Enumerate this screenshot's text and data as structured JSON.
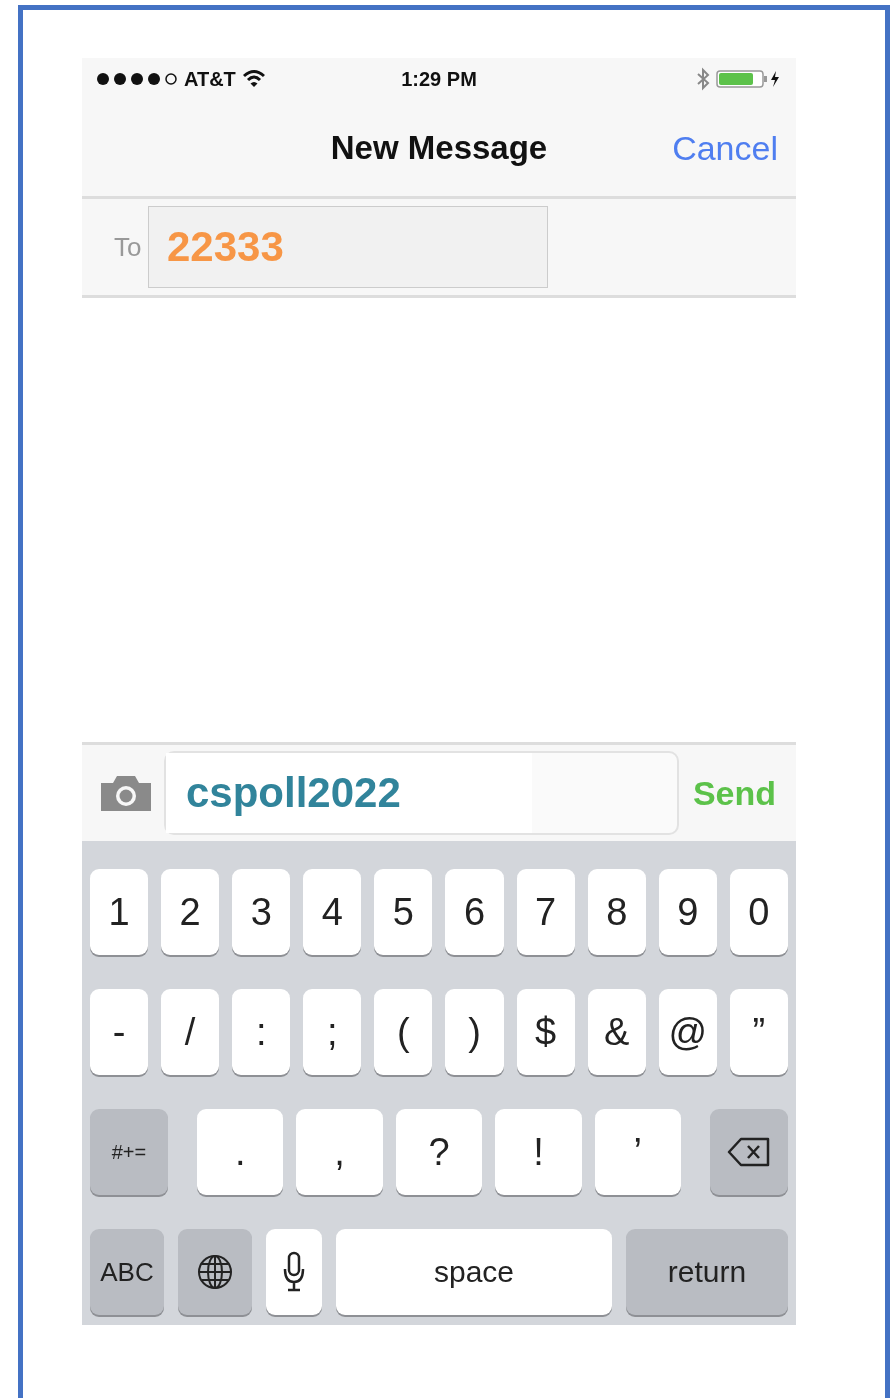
{
  "status_bar": {
    "carrier": "AT&T",
    "time": "1:29 PM"
  },
  "nav_bar": {
    "title": "New Message",
    "cancel": "Cancel"
  },
  "recipient": {
    "label": "To",
    "value": "22333"
  },
  "composer": {
    "value": "cspoll2022",
    "send": "Send"
  },
  "keyboard": {
    "rows": [
      {
        "keys": [
          {
            "kind": "char",
            "label": "1"
          },
          {
            "kind": "char",
            "label": "2"
          },
          {
            "kind": "char",
            "label": "3"
          },
          {
            "kind": "char",
            "label": "4"
          },
          {
            "kind": "char",
            "label": "5"
          },
          {
            "kind": "char",
            "label": "6"
          },
          {
            "kind": "char",
            "label": "7"
          },
          {
            "kind": "char",
            "label": "8"
          },
          {
            "kind": "char",
            "label": "9"
          },
          {
            "kind": "char",
            "label": "0"
          }
        ]
      },
      {
        "keys": [
          {
            "kind": "char",
            "label": "-"
          },
          {
            "kind": "char",
            "label": "/"
          },
          {
            "kind": "char",
            "label": ":"
          },
          {
            "kind": "char",
            "label": ";"
          },
          {
            "kind": "char",
            "label": "("
          },
          {
            "kind": "char",
            "label": ")"
          },
          {
            "kind": "char",
            "label": "$"
          },
          {
            "kind": "char",
            "label": "&"
          },
          {
            "kind": "char",
            "label": "@"
          },
          {
            "kind": "char",
            "label": "”"
          }
        ]
      },
      {
        "keys": [
          {
            "kind": "function",
            "label": "#+="
          },
          {
            "kind": "wide",
            "label": "."
          },
          {
            "kind": "wide",
            "label": ","
          },
          {
            "kind": "wide",
            "label": "?"
          },
          {
            "kind": "wide",
            "label": "!"
          },
          {
            "kind": "wide",
            "label": "’"
          },
          {
            "kind": "backspace"
          }
        ]
      },
      {
        "keys": [
          {
            "kind": "abc",
            "label": "ABC"
          },
          {
            "kind": "globe"
          },
          {
            "kind": "mic"
          },
          {
            "kind": "space",
            "label": "space"
          },
          {
            "kind": "return",
            "label": "return"
          }
        ]
      }
    ]
  }
}
